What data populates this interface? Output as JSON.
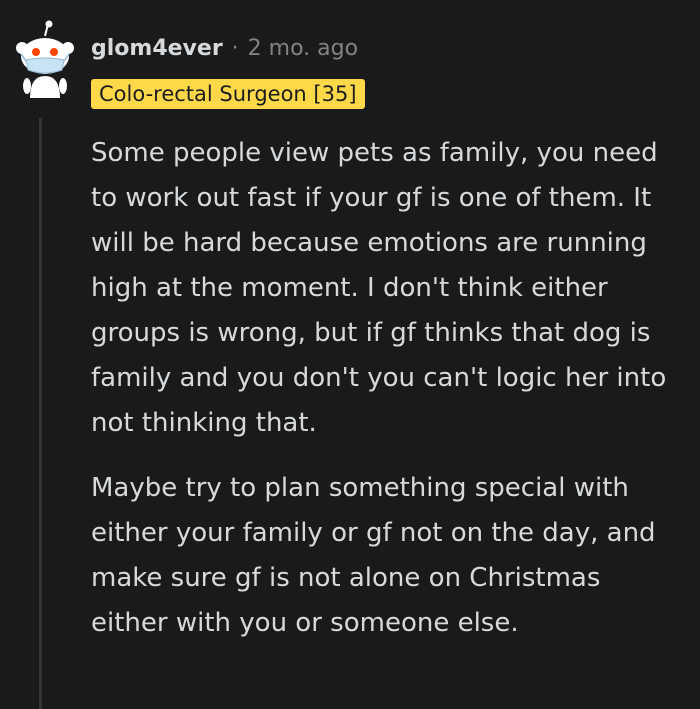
{
  "comment": {
    "username": "glom4ever",
    "separator": "·",
    "timestamp": "2 mo. ago",
    "flair": "Colo-rectal Surgeon [35]",
    "paragraphs": [
      "Some people view pets as family, you need to work out fast if your gf is one of them. It will be hard because emotions are running high at the moment. I don't think either groups is wrong, but if gf thinks that dog is family and you don't you can't logic her into not thinking that.",
      "Maybe try to plan something special with either your family or gf not on the day, and make sure gf is not alone on Christmas either with you or someone else."
    ]
  },
  "colors": {
    "background": "#1a1a1b",
    "text": "#d7dadc",
    "meta": "#818384",
    "flair_background": "#fdd94a",
    "thread_line": "#343536",
    "avatar_accent": "#ff4500"
  },
  "icons": {
    "avatar": "snoo-avatar-with-mask"
  }
}
